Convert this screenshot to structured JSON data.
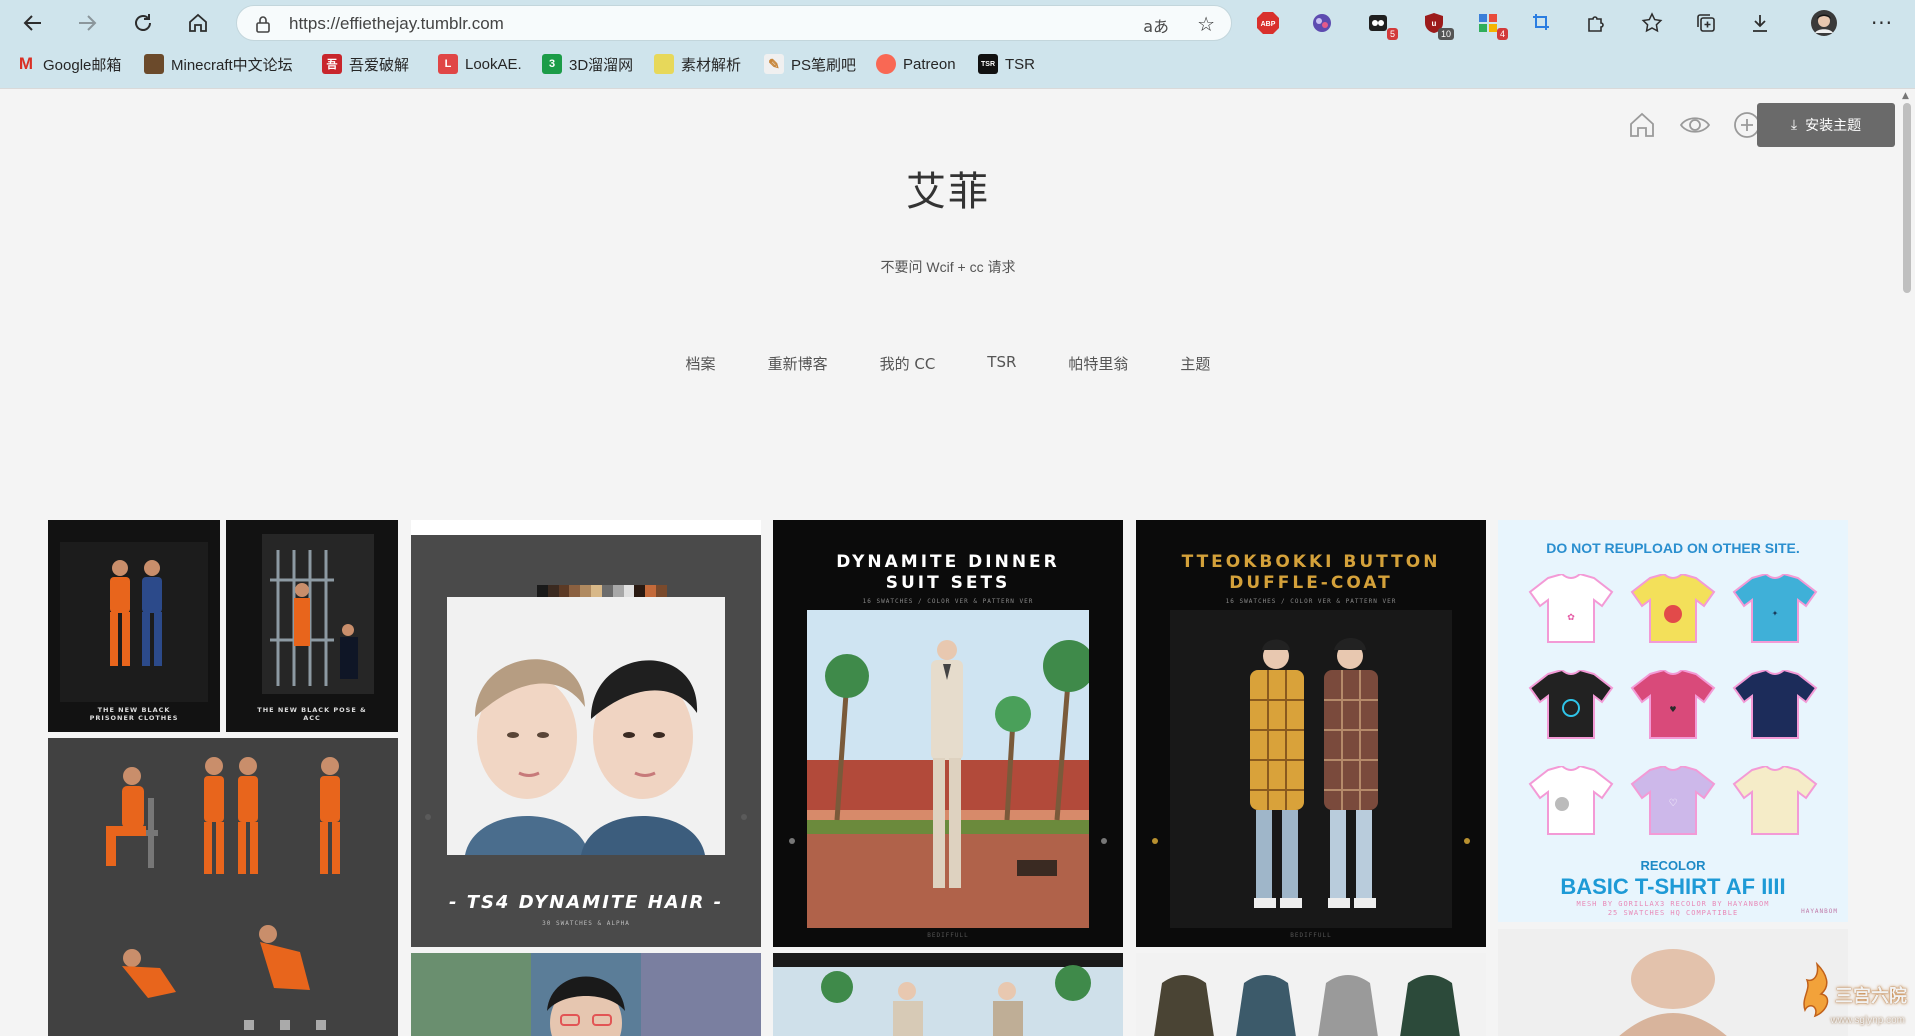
{
  "browser": {
    "url": "https://effiethejay.tumblr.com",
    "translate_label": "aあ",
    "extensions": [
      {
        "name": "adblock-plus",
        "label": "ABP",
        "badge": ""
      },
      {
        "name": "extension-purple",
        "label": "",
        "badge": ""
      },
      {
        "name": "extension-dark",
        "label": "",
        "badge": "5"
      },
      {
        "name": "ublock",
        "label": "",
        "badge": "10"
      },
      {
        "name": "extension-multi",
        "label": "",
        "badge": "4"
      }
    ],
    "bookmarks": [
      {
        "label": "Google邮箱",
        "icon": "M"
      },
      {
        "label": "Minecraft中文论坛",
        "icon": ""
      },
      {
        "label": "吾爱破解",
        "icon": "吾"
      },
      {
        "label": "LookAE.",
        "icon": "L"
      },
      {
        "label": "3D溜溜网",
        "icon": "3"
      },
      {
        "label": "素材解析",
        "icon": ""
      },
      {
        "label": "PS笔刷吧",
        "icon": ""
      },
      {
        "label": "Patreon",
        "icon": ""
      },
      {
        "label": "TSR",
        "icon": "TSR"
      }
    ]
  },
  "page": {
    "install_label": "安装主题",
    "title": "艾菲",
    "description": "不要问 Wcif + cc 请求",
    "nav": [
      "档案",
      "重新博客",
      "我的 CC",
      "TSR",
      "帕特里翁",
      "主题"
    ]
  },
  "posts": {
    "prisoner_clothes": {
      "caption": "THE NEW BLACK PRISONER CLOTHES"
    },
    "prisoner_pose": {
      "caption": "THE NEW BLACK POSE & ACC"
    },
    "hair": {
      "title": "- TS4 DYNAMITE HAIR -",
      "sub": "30 SWATCHES & ALPHA"
    },
    "suit": {
      "title_1": "DYNAMITE DINNER",
      "title_2": "SUIT SETS",
      "sub": "16 SWATCHES / COLOR VER & PATTERN VER",
      "footer": "BEDIFFULL"
    },
    "coat": {
      "title_1": "TTEOKBOKKI BUTTON",
      "title_2": "DUFFLE-COAT",
      "sub": "16 SWATCHES / COLOR VER & PATTERN VER",
      "footer": "BEDIFFULL"
    },
    "tshirt": {
      "top_text": "DO NOT REUPLOAD ON OTHER SITE.",
      "recolor": "RECOLOR",
      "title": "BASIC T-SHIRT AF IIII",
      "sub_1": "MESH BY GORILLAX3 RECOLOR BY HAYANBOM",
      "sub_2": "25 SWATCHES HQ COMPATIBLE",
      "credit": "HAYANBOM"
    }
  },
  "watermark": {
    "text": "三宫六院",
    "url": "www.sglynp.com"
  },
  "colors": {
    "chrome": "#cfe4ec",
    "page_bg": "#f4f4f4",
    "prison_orange": "#e8651c",
    "coat_title": "#d4a13a",
    "tshirt_blue": "#1e9ad6"
  }
}
